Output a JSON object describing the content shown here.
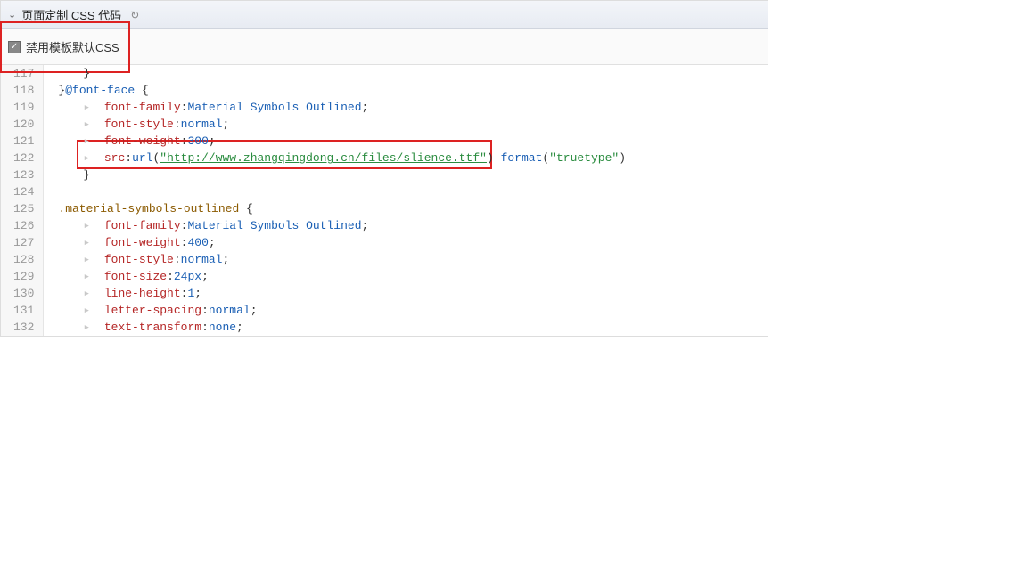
{
  "panel": {
    "title": "页面定制 CSS 代码"
  },
  "checkbox": {
    "label": "禁用模板默认CSS",
    "checked": true
  },
  "code": {
    "lines": [
      {
        "num": "117",
        "segments": [
          {
            "t": "tab"
          },
          {
            "cls": "punc",
            "txt": "}"
          }
        ]
      },
      {
        "num": "118",
        "segments": [
          {
            "cls": "punc",
            "txt": "}"
          },
          {
            "cls": "kw",
            "txt": "@font-face"
          },
          {
            "cls": "punc",
            "txt": " {"
          }
        ]
      },
      {
        "num": "119",
        "segments": [
          {
            "t": "tab"
          },
          {
            "cls": "arrow",
            "txt": "▸"
          },
          {
            "cls": "",
            "txt": "  "
          },
          {
            "cls": "prop",
            "txt": "font-family"
          },
          {
            "cls": "punc",
            "txt": ":"
          },
          {
            "cls": "val",
            "txt": "Material Symbols Outlined"
          },
          {
            "cls": "punc",
            "txt": ";"
          }
        ]
      },
      {
        "num": "120",
        "segments": [
          {
            "t": "tab"
          },
          {
            "cls": "arrow",
            "txt": "▸"
          },
          {
            "cls": "",
            "txt": "  "
          },
          {
            "cls": "prop",
            "txt": "font-style"
          },
          {
            "cls": "punc",
            "txt": ":"
          },
          {
            "cls": "val",
            "txt": "normal"
          },
          {
            "cls": "punc",
            "txt": ";"
          }
        ]
      },
      {
        "num": "121",
        "segments": [
          {
            "t": "tab"
          },
          {
            "cls": "arrow",
            "txt": "▸"
          },
          {
            "cls": "",
            "txt": "  "
          },
          {
            "cls": "prop",
            "txt": "font-weight"
          },
          {
            "cls": "punc",
            "txt": ":"
          },
          {
            "cls": "num",
            "txt": "300"
          },
          {
            "cls": "punc",
            "txt": ";"
          }
        ]
      },
      {
        "num": "122",
        "segments": [
          {
            "t": "tab"
          },
          {
            "cls": "arrow",
            "txt": "▸"
          },
          {
            "cls": "",
            "txt": "  "
          },
          {
            "cls": "prop",
            "txt": "src"
          },
          {
            "cls": "punc",
            "txt": ":"
          },
          {
            "cls": "val",
            "txt": "url"
          },
          {
            "cls": "punc",
            "txt": "("
          },
          {
            "cls": "str url-u",
            "txt": "\"http://www.zhangqingdong.cn/files/slience.ttf\""
          },
          {
            "cls": "punc",
            "txt": ")"
          },
          {
            "cls": "",
            "txt": " "
          },
          {
            "cls": "val",
            "txt": "format"
          },
          {
            "cls": "punc",
            "txt": "("
          },
          {
            "cls": "str",
            "txt": "\"truetype\""
          },
          {
            "cls": "punc",
            "txt": ")"
          }
        ]
      },
      {
        "num": "123",
        "segments": [
          {
            "t": "tab"
          },
          {
            "cls": "punc",
            "txt": "}"
          }
        ]
      },
      {
        "num": "124",
        "segments": []
      },
      {
        "num": "125",
        "segments": [
          {
            "cls": "sel",
            "txt": ".material-symbols-outlined"
          },
          {
            "cls": "punc",
            "txt": " {"
          }
        ]
      },
      {
        "num": "126",
        "segments": [
          {
            "t": "tab"
          },
          {
            "cls": "arrow",
            "txt": "▸"
          },
          {
            "cls": "",
            "txt": "  "
          },
          {
            "cls": "prop",
            "txt": "font-family"
          },
          {
            "cls": "punc",
            "txt": ":"
          },
          {
            "cls": "val",
            "txt": "Material Symbols Outlined"
          },
          {
            "cls": "punc",
            "txt": ";"
          }
        ]
      },
      {
        "num": "127",
        "segments": [
          {
            "t": "tab"
          },
          {
            "cls": "arrow",
            "txt": "▸"
          },
          {
            "cls": "",
            "txt": "  "
          },
          {
            "cls": "prop",
            "txt": "font-weight"
          },
          {
            "cls": "punc",
            "txt": ":"
          },
          {
            "cls": "num",
            "txt": "400"
          },
          {
            "cls": "punc",
            "txt": ";"
          }
        ]
      },
      {
        "num": "128",
        "segments": [
          {
            "t": "tab"
          },
          {
            "cls": "arrow",
            "txt": "▸"
          },
          {
            "cls": "",
            "txt": "  "
          },
          {
            "cls": "prop",
            "txt": "font-style"
          },
          {
            "cls": "punc",
            "txt": ":"
          },
          {
            "cls": "val",
            "txt": "normal"
          },
          {
            "cls": "punc",
            "txt": ";"
          }
        ]
      },
      {
        "num": "129",
        "segments": [
          {
            "t": "tab"
          },
          {
            "cls": "arrow",
            "txt": "▸"
          },
          {
            "cls": "",
            "txt": "  "
          },
          {
            "cls": "prop",
            "txt": "font-size"
          },
          {
            "cls": "punc",
            "txt": ":"
          },
          {
            "cls": "num",
            "txt": "24px"
          },
          {
            "cls": "punc",
            "txt": ";"
          }
        ]
      },
      {
        "num": "130",
        "segments": [
          {
            "t": "tab"
          },
          {
            "cls": "arrow",
            "txt": "▸"
          },
          {
            "cls": "",
            "txt": "  "
          },
          {
            "cls": "prop",
            "txt": "line-height"
          },
          {
            "cls": "punc",
            "txt": ":"
          },
          {
            "cls": "num",
            "txt": "1"
          },
          {
            "cls": "punc",
            "txt": ";"
          }
        ]
      },
      {
        "num": "131",
        "segments": [
          {
            "t": "tab"
          },
          {
            "cls": "arrow",
            "txt": "▸"
          },
          {
            "cls": "",
            "txt": "  "
          },
          {
            "cls": "prop",
            "txt": "letter-spacing"
          },
          {
            "cls": "punc",
            "txt": ":"
          },
          {
            "cls": "val",
            "txt": "normal"
          },
          {
            "cls": "punc",
            "txt": ";"
          }
        ]
      },
      {
        "num": "132",
        "segments": [
          {
            "t": "tab"
          },
          {
            "cls": "arrow",
            "txt": "▸"
          },
          {
            "cls": "",
            "txt": "  "
          },
          {
            "cls": "prop",
            "txt": "text-transform"
          },
          {
            "cls": "punc",
            "txt": ":"
          },
          {
            "cls": "val",
            "txt": "none"
          },
          {
            "cls": "punc",
            "txt": ";"
          }
        ]
      }
    ]
  }
}
